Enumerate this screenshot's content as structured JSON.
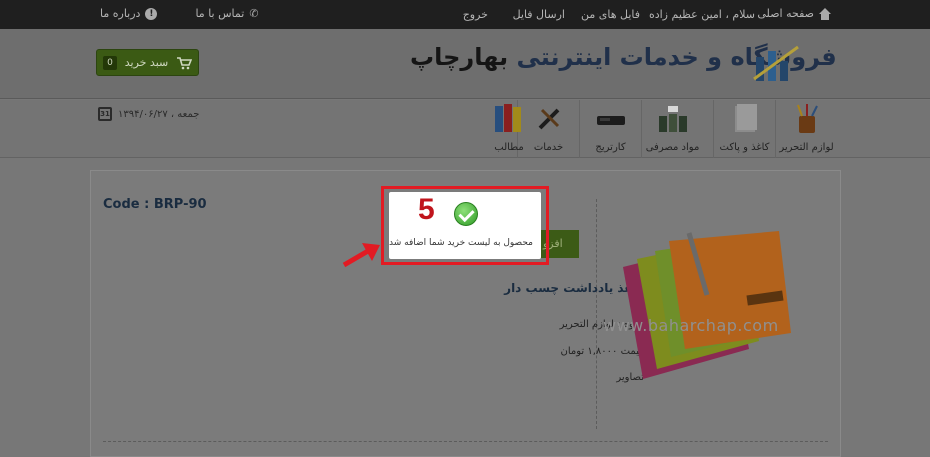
{
  "topbar": {
    "home": "صفحه اصلی",
    "greeting": "سلام ، امین عظیم زاده",
    "my_files": "فایل های من",
    "send_file": "ارسال فایل",
    "logout": "خروج",
    "contact": "تماس با ما",
    "about": "درباره ما"
  },
  "header": {
    "brand_prefix": "فروشگاه و خدمات اینترنتی",
    "brand_name": "بهارچاپ",
    "cart_label": "سبد خرید",
    "cart_count": "0"
  },
  "categories": [
    {
      "label": "لوازم التحریر",
      "icon": "pencil-cup-icon"
    },
    {
      "label": "کاغذ و پاکت",
      "icon": "paper-stack-icon"
    },
    {
      "label": "مواد مصرفی",
      "icon": "ink-bottles-icon"
    },
    {
      "label": "کارتریج",
      "icon": "cartridge-icon"
    },
    {
      "label": "خدمات",
      "icon": "tools-icon"
    },
    {
      "label": "مطالب",
      "icon": "books-icon"
    }
  ],
  "date": {
    "text": "جمعه ، ۱۳۹۴/۰۶/۲۷",
    "icon_text": "31"
  },
  "product": {
    "code": "Code : BRP-90",
    "add_button": "افزو",
    "name": "کاغذ یادداشت چسب دار",
    "group": "گروه : لوازم التحریر",
    "price": "قیمت ۱,۸۰۰۰ تومان",
    "images": "تصاویر",
    "watermark": "www.baharchap.com"
  },
  "popup": {
    "message": "محصول به لیست خرید شما اضافه شد",
    "step_number": "5"
  },
  "colors": {
    "accent_red": "#e21b23",
    "cart_green": "#3b5a14",
    "heading_blue": "#1a2c40"
  }
}
